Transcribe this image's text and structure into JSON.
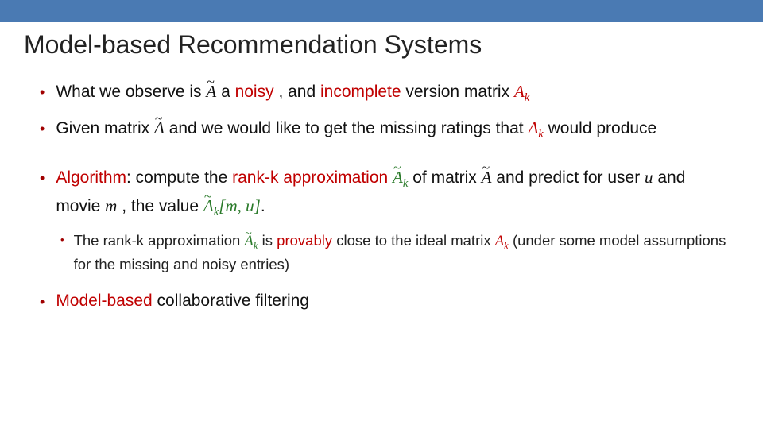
{
  "title": "Model-based Recommendation Systems",
  "b1": {
    "pre": "What we observe is ",
    "noisy": "noisy",
    "mid": ", and ",
    "incomplete": "incomplete",
    "post": " version matrix ",
    "a": " a "
  },
  "b2": {
    "pre": "Given matrix ",
    "mid": " and we would like to get the missing ratings that ",
    "post": " would produce"
  },
  "b3": {
    "alg": "Algorithm",
    "t1": ": compute the ",
    "rk": "rank-k approximation",
    "t2": " of matrix ",
    "t3": " and predict for user ",
    "t4": " and movie ",
    "t5": ", the value ",
    "dot": "."
  },
  "s1": {
    "t1": "The rank-k approximation ",
    "t2": " is ",
    "prov": "provably",
    "t3": " close to the ideal matrix ",
    "t4": " (under some model assumptions for the missing and noisy entries)"
  },
  "b4": {
    "mb": "Model-based",
    "rest": " collaborative filtering"
  },
  "sym": {
    "A": "A",
    "Ak": "A",
    "k": "k",
    "u": "u",
    "m": "m",
    "lb": "[",
    "rb": "]",
    "comma": ", ",
    "tilde": "~"
  }
}
